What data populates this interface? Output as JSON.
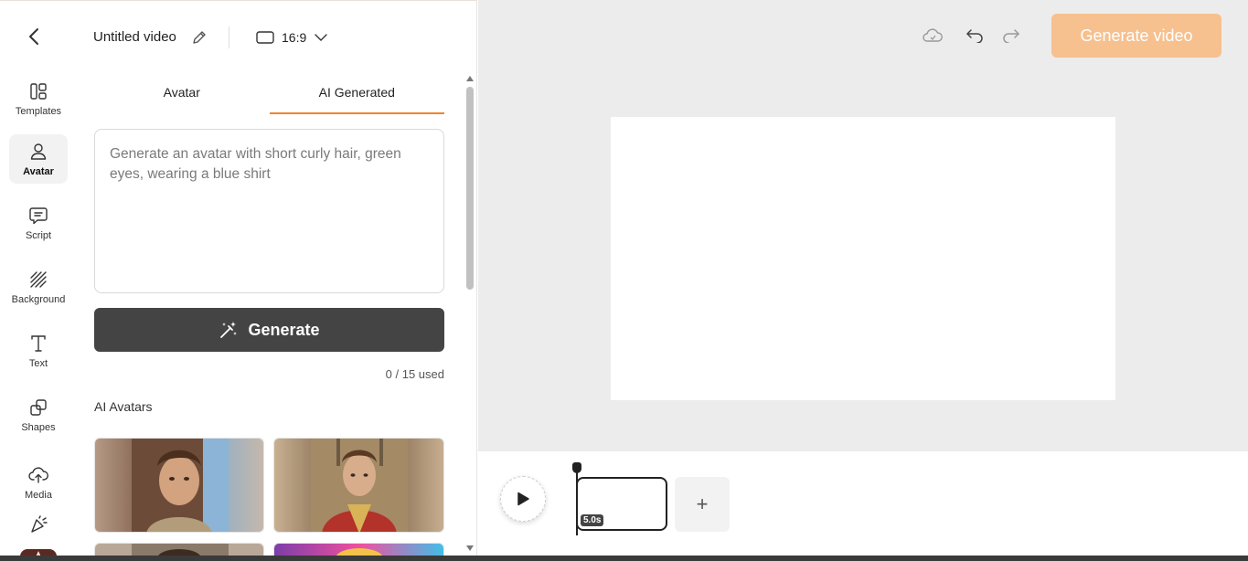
{
  "header": {
    "video_title": "Untitled video",
    "aspect_ratio": "16:9"
  },
  "sidebar": {
    "items": [
      {
        "label": "Templates"
      },
      {
        "label": "Avatar"
      },
      {
        "label": "Script"
      },
      {
        "label": "Background"
      },
      {
        "label": "Text"
      },
      {
        "label": "Shapes"
      },
      {
        "label": "Media"
      }
    ],
    "active": "Avatar"
  },
  "panel": {
    "tabs": [
      {
        "label": "Avatar"
      },
      {
        "label": "AI Generated"
      }
    ],
    "active_tab": "AI Generated",
    "prompt_placeholder": "Generate an avatar with short curly hair, green eyes, wearing a blue shirt",
    "generate_label": "Generate",
    "usage": "0 / 15 used",
    "section_title": "AI Avatars"
  },
  "toolbar": {
    "generate_video_label": "Generate video"
  },
  "timeline": {
    "clip_duration": "5.0s",
    "add_label": "+"
  },
  "colors": {
    "accent": "#f0852d",
    "generate_video_bg": "#f6c08f",
    "generate_bg": "#444444",
    "workspace_bg": "#ececec"
  }
}
